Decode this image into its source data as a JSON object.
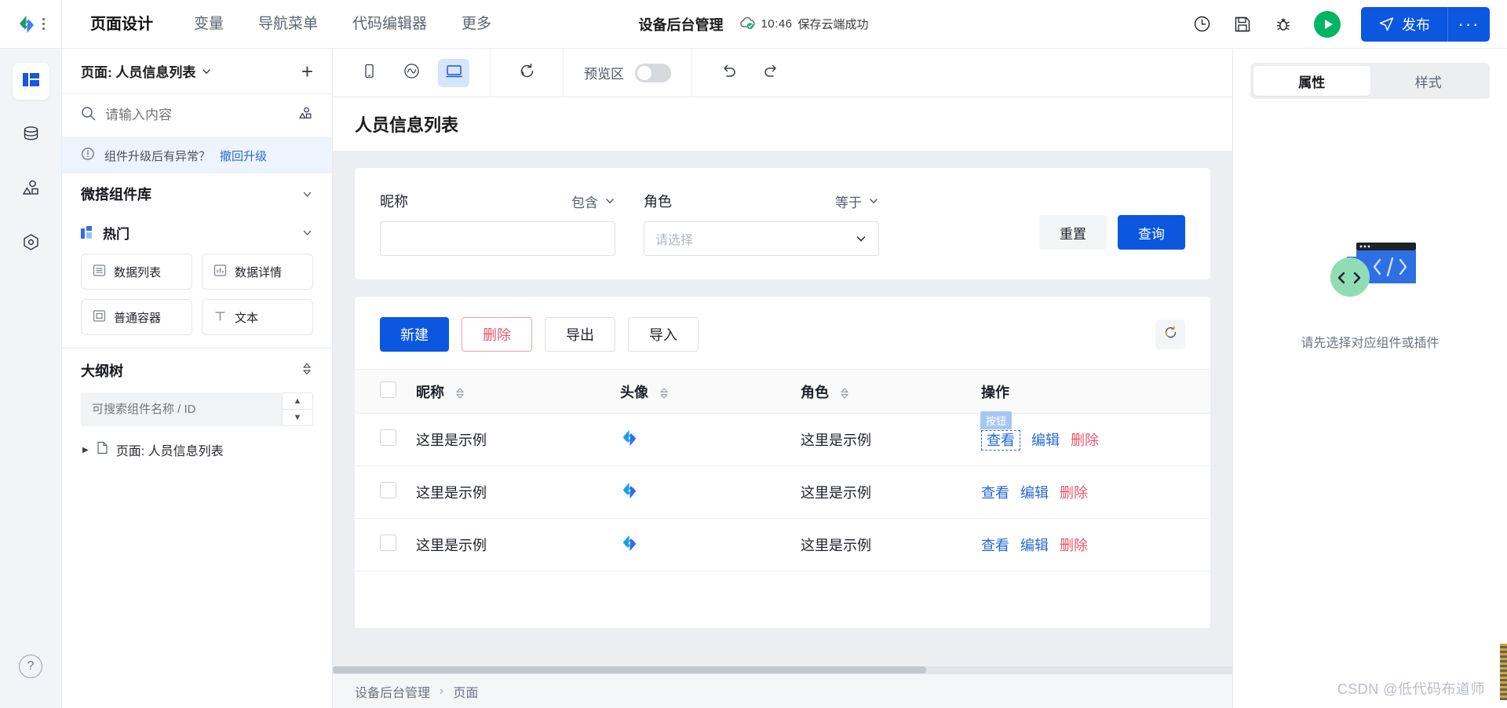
{
  "header": {
    "logo_icon": "weda-logo-icon",
    "grip_icon": "grip-dots-icon",
    "menu": [
      {
        "label": "页面设计",
        "active": true
      },
      {
        "label": "变量",
        "active": false
      },
      {
        "label": "导航菜单",
        "active": false
      },
      {
        "label": "代码编辑器",
        "active": false
      },
      {
        "label": "更多",
        "active": false
      }
    ],
    "project_name": "设备后台管理",
    "save_icon": "cloud-check-icon",
    "save_time": "10:46",
    "save_status": "保存云端成功",
    "actions": {
      "history_icon": "clock-history-icon",
      "save_icon": "floppy-save-icon",
      "debug_icon": "bug-debug-icon",
      "preview_icon": "play-circle-icon",
      "publish_label": "发布",
      "publish_icon": "send-plane-icon",
      "more_label": "···"
    },
    "accent_blue": "#0b57e0",
    "accent_green": "#00b561"
  },
  "rail": {
    "items": [
      {
        "name": "page-layout",
        "icon": "layout-panel-icon",
        "active": true
      },
      {
        "name": "data-source",
        "icon": "database-icon",
        "active": false
      },
      {
        "name": "components",
        "icon": "shapes-icon",
        "active": false
      },
      {
        "name": "plugins",
        "icon": "hexagon-gear-icon",
        "active": false
      }
    ],
    "help_icon": "question-circle-icon"
  },
  "panel": {
    "page_label": "页面: 人员信息列表",
    "page_chevron_icon": "chevron-down-icon",
    "add_icon": "plus-icon",
    "search": {
      "placeholder": "请输入内容",
      "icon": "search-icon",
      "right_icon": "shapes-icon"
    },
    "notice": {
      "icon": "info-circle-icon",
      "text": "组件升级后有异常？",
      "link": "撤回升级"
    },
    "library_title": "微搭组件库",
    "library_chevron_icon": "chevron-down-icon",
    "group_title": "热门",
    "group_icon": "hot-blocks-icon",
    "group_chevron_icon": "chevron-down-icon",
    "components": [
      {
        "label": "数据列表",
        "icon": "list-icon"
      },
      {
        "label": "数据详情",
        "icon": "chart-bar-icon"
      },
      {
        "label": "普通容器",
        "icon": "square-icon"
      },
      {
        "label": "文本",
        "icon": "text-T-icon"
      }
    ],
    "tree_title": "大纲树",
    "tree_sort_icon": "sort-updown-icon",
    "tree_search_placeholder": "可搜索组件名称 / ID",
    "tree_up_icon": "chevron-up-icon",
    "tree_down_icon": "chevron-down-icon",
    "tree_items": [
      {
        "label": "页面: 人员信息列表",
        "icon": "file-icon",
        "caret_icon": "caret-right-icon"
      }
    ]
  },
  "toolbar": {
    "devices": [
      {
        "name": "mobile",
        "icon": "mobile-icon",
        "active": false
      },
      {
        "name": "miniprogram",
        "icon": "miniprogram-icon",
        "active": false
      },
      {
        "name": "desktop",
        "icon": "desktop-icon",
        "active": true
      }
    ],
    "refresh_icon": "refresh-icon",
    "preview_label": "预览区",
    "preview_on": false,
    "undo_icon": "undo-icon",
    "redo_icon": "redo-icon"
  },
  "canvas": {
    "page_title": "人员信息列表",
    "filters": [
      {
        "label": "昵称",
        "operator": "包含",
        "value": "",
        "placeholder": "",
        "type": "input"
      },
      {
        "label": "角色",
        "operator": "等于",
        "value": "",
        "placeholder": "请选择",
        "type": "select"
      }
    ],
    "filter_buttons": {
      "reset": "重置",
      "search": "查询"
    },
    "table_buttons": [
      {
        "label": "新建",
        "style": "primary"
      },
      {
        "label": "删除",
        "style": "danger"
      },
      {
        "label": "导出",
        "style": "plain"
      },
      {
        "label": "导入",
        "style": "plain"
      }
    ],
    "table_refresh_icon": "refresh-icon",
    "table": {
      "columns": [
        {
          "label": "",
          "type": "checkbox"
        },
        {
          "label": "昵称",
          "sortable": true
        },
        {
          "label": "头像",
          "sortable": true
        },
        {
          "label": "角色",
          "sortable": true
        },
        {
          "label": "操作",
          "sortable": false
        }
      ],
      "rows": [
        {
          "nickname": "这里是示例",
          "avatar_icon": "weda-avatar-icon",
          "role": "这里是示例",
          "actions": [
            {
              "label": "查看",
              "kind": "link",
              "selected": true
            },
            {
              "label": "编辑",
              "kind": "link"
            },
            {
              "label": "删除",
              "kind": "danger"
            }
          ]
        },
        {
          "nickname": "这里是示例",
          "avatar_icon": "weda-avatar-icon",
          "role": "这里是示例",
          "actions": [
            {
              "label": "查看",
              "kind": "link"
            },
            {
              "label": "编辑",
              "kind": "link"
            },
            {
              "label": "删除",
              "kind": "danger"
            }
          ]
        },
        {
          "nickname": "这里是示例",
          "avatar_icon": "weda-avatar-icon",
          "role": "这里是示例",
          "actions": [
            {
              "label": "查看",
              "kind": "link"
            },
            {
              "label": "编辑",
              "kind": "link"
            },
            {
              "label": "删除",
              "kind": "danger"
            }
          ]
        }
      ],
      "selection_tag": "按钮"
    },
    "breadcrumb": [
      "设备后台管理",
      "页面"
    ],
    "breadcrumb_sep": "›"
  },
  "props": {
    "tabs": [
      {
        "label": "属性",
        "active": true
      },
      {
        "label": "样式",
        "active": false
      }
    ],
    "empty_text": "请先选择对应组件或插件",
    "empty_icon": "empty-code-bubble-icon"
  },
  "watermark": "CSDN @低代码布道师"
}
